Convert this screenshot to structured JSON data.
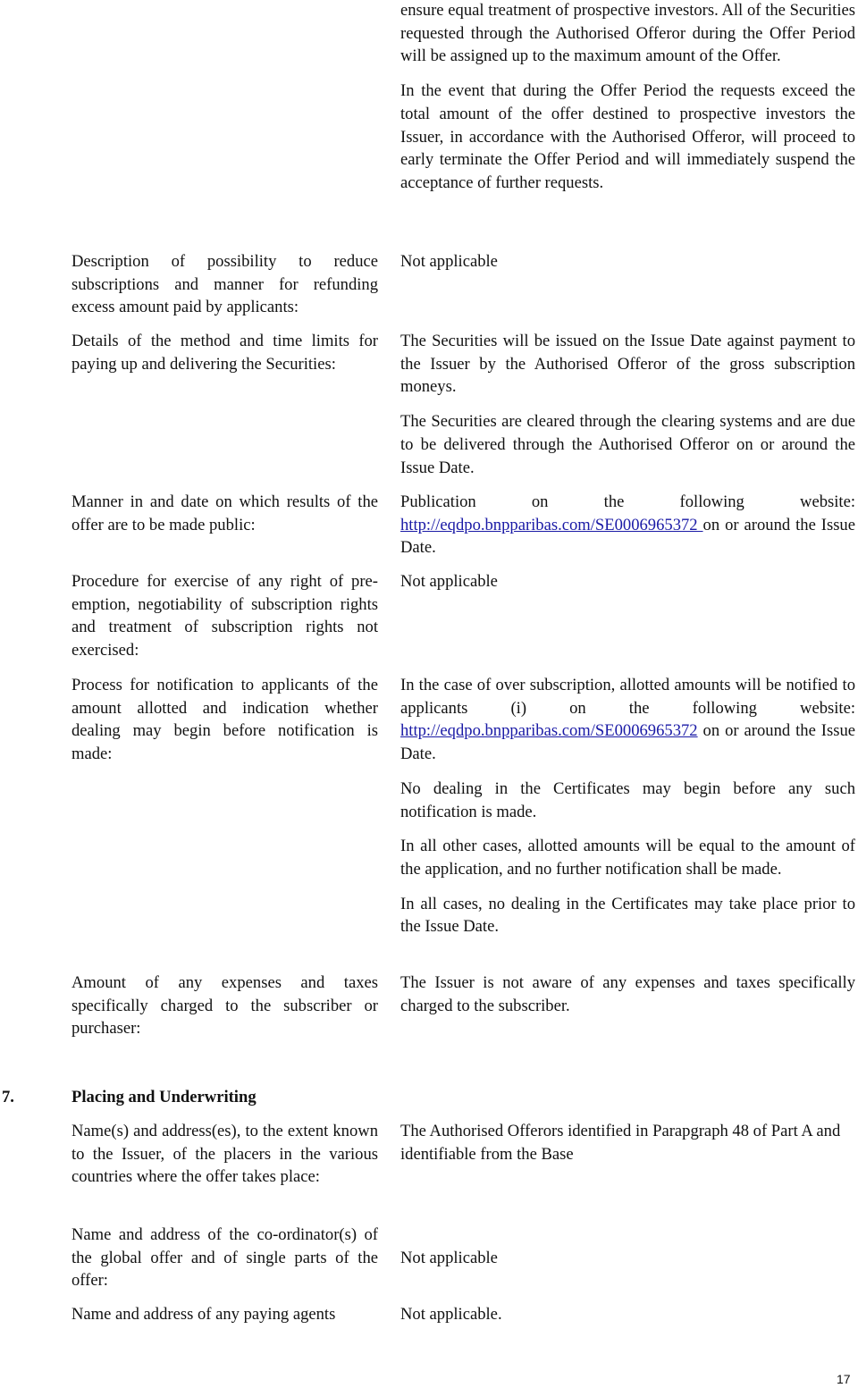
{
  "top_right": {
    "para1": "ensure equal treatment of prospective investors. All of the Securities requested through the Authorised Offeror during the Offer Period will be assigned up to the maximum amount of the Offer.",
    "para2": "In the event that during the Offer Period the requests exceed the total amount of the offer destined to prospective investors the Issuer, in accordance with the Authorised Offeror, will proceed to early terminate the Offer Period and will immediately suspend the acceptance of further requests."
  },
  "rows": [
    {
      "label": "Description of possibility to reduce subscriptions and manner for refunding excess amount paid by applicants:",
      "value": "Not applicable"
    },
    {
      "label": "Details of the method and time limits for paying up and delivering the Securities:",
      "value_p1": "The Securities will be issued on the Issue Date against payment to the Issuer by the Authorised Offeror of the gross subscription moneys.",
      "value_p2": "The Securities are cleared through the clearing systems and are due to be delivered through the Authorised Offeror on or around the Issue Date."
    },
    {
      "label": "Manner in and date on which results of the offer are to be made public:",
      "value_pre": "Publication on the following website:",
      "link": "http://eqdpo.bnpparibas.com/SE0006965372 ",
      "value_post": "on or around the Issue Date."
    },
    {
      "label": "Procedure for exercise of any right of pre-emption, negotiability of subscription rights and treatment of subscription rights not exercised:",
      "value": "Not applicable"
    },
    {
      "label": "Process for notification to applicants of the amount allotted and indication whether dealing may begin before notification is made:",
      "value_pre": "In the case of over subscription, allotted amounts will be notified to applicants (i) on the following website:",
      "link": "http://eqdpo.bnpparibas.com/SE0006965372",
      "value_post": " on or around the Issue Date.",
      "value_p2": "No dealing in the Certificates may begin before any such notification is made.",
      "value_p3": "In all other cases, allotted amounts will be equal to the amount of the application, and no further notification shall be made.",
      "value_p4": "In all cases, no dealing in the Certificates may take place prior to the Issue Date."
    },
    {
      "label": "Amount of any expenses and taxes specifically charged to the subscriber or purchaser:",
      "value": "The Issuer is not aware of any expenses and taxes specifically charged to the subscriber."
    }
  ],
  "section7": {
    "number": "7.",
    "title": "Placing and Underwriting",
    "rows": [
      {
        "label": "Name(s) and address(es), to the extent known to the Issuer, of the placers in the various countries where the offer takes place:",
        "value": "The Authorised Offerors identified in Parapgraph 48 of Part A and identifiable from the Base"
      },
      {
        "label": "Name and address of the co-ordinator(s) of the global offer and of single parts of the offer:",
        "value": "Not applicable"
      },
      {
        "label": "Name and address of any paying agents",
        "value": "Not applicable."
      }
    ]
  },
  "page_number": "17"
}
